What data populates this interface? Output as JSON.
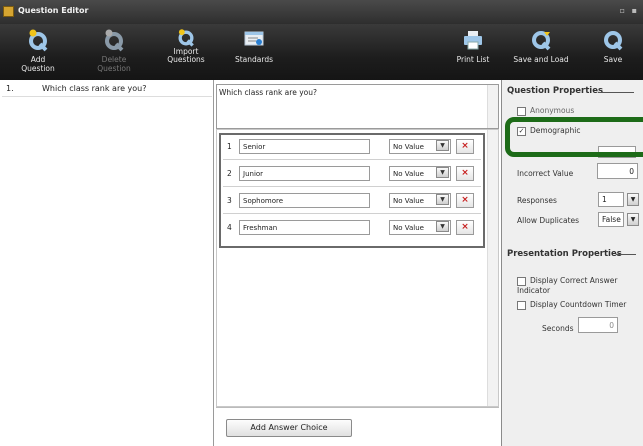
{
  "window": {
    "title": "Question Editor"
  },
  "toolbar": {
    "add_question": "Add Question",
    "delete_question": "Delete Question",
    "import_questions_1": "Import",
    "import_questions_2": "Questions",
    "standards": "Standards",
    "print_list": "Print List",
    "save_and_load": "Save and Load",
    "save": "Save"
  },
  "question_list": [
    {
      "number": "1.",
      "text": "Which class rank are you?"
    }
  ],
  "editor": {
    "question_text": "Which class rank are you?",
    "answers": [
      {
        "number": "1",
        "text": "Senior",
        "value": "No Value"
      },
      {
        "number": "2",
        "text": "Junior",
        "value": "No Value"
      },
      {
        "number": "3",
        "text": "Sophomore",
        "value": "No Value"
      },
      {
        "number": "4",
        "text": "Freshman",
        "value": "No Value"
      }
    ],
    "add_answer_label": "Add Answer Choice"
  },
  "properties": {
    "question_title": "Question Properties",
    "anonymous_label": "Anonymous",
    "demographic_label": "Demographic",
    "demographic_checked": true,
    "incorrect_value_label": "Incorrect Value",
    "incorrect_value": "0",
    "responses_label": "Responses",
    "responses_value": "1",
    "allow_duplicates_label": "Allow Duplicates",
    "allow_duplicates_value": "False",
    "presentation_title": "Presentation Properties",
    "display_correct_label": "Display Correct Answer Indicator",
    "display_timer_label": "Display Countdown Timer",
    "seconds_label": "Seconds",
    "seconds_value": "0"
  },
  "colors": {
    "highlight": "#1d6b18",
    "delete_icon": "#c61c1c",
    "toolbar_icon": "#9ec6e8"
  }
}
